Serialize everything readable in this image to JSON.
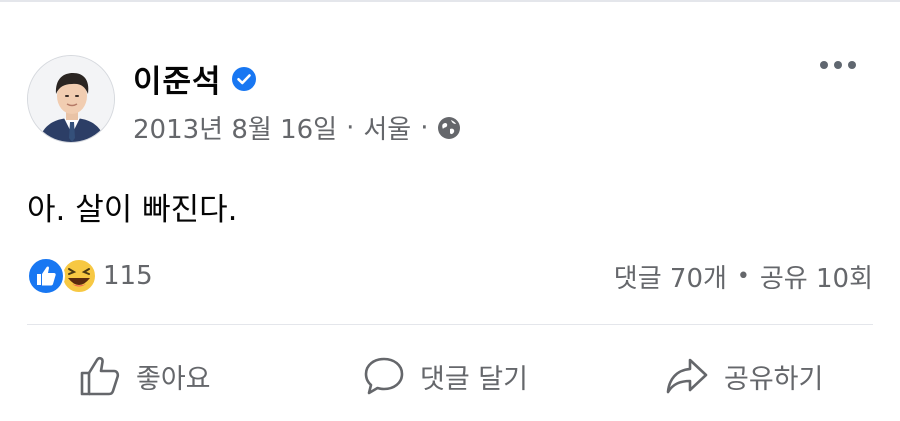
{
  "post": {
    "author_name": "이준석",
    "verified": true,
    "date": "2013년 8월 16일",
    "separator": "·",
    "location": "서울",
    "audience_icon": "globe-icon",
    "text": "아. 살이 빠진다.",
    "reaction_count": "115",
    "reaction_types": [
      "like-icon",
      "haha-icon"
    ],
    "comments": "댓글 70개",
    "stats_separator": "•",
    "shares": "공유 10회"
  },
  "actions": {
    "like_label": "좋아요",
    "comment_label": "댓글 달기",
    "share_label": "공유하기"
  },
  "colors": {
    "verified_blue": "#1877f2",
    "like_blue": "#1877f2",
    "haha_yellow": "#f7c843",
    "secondary_text": "#65676b",
    "primary_text": "#050505"
  }
}
